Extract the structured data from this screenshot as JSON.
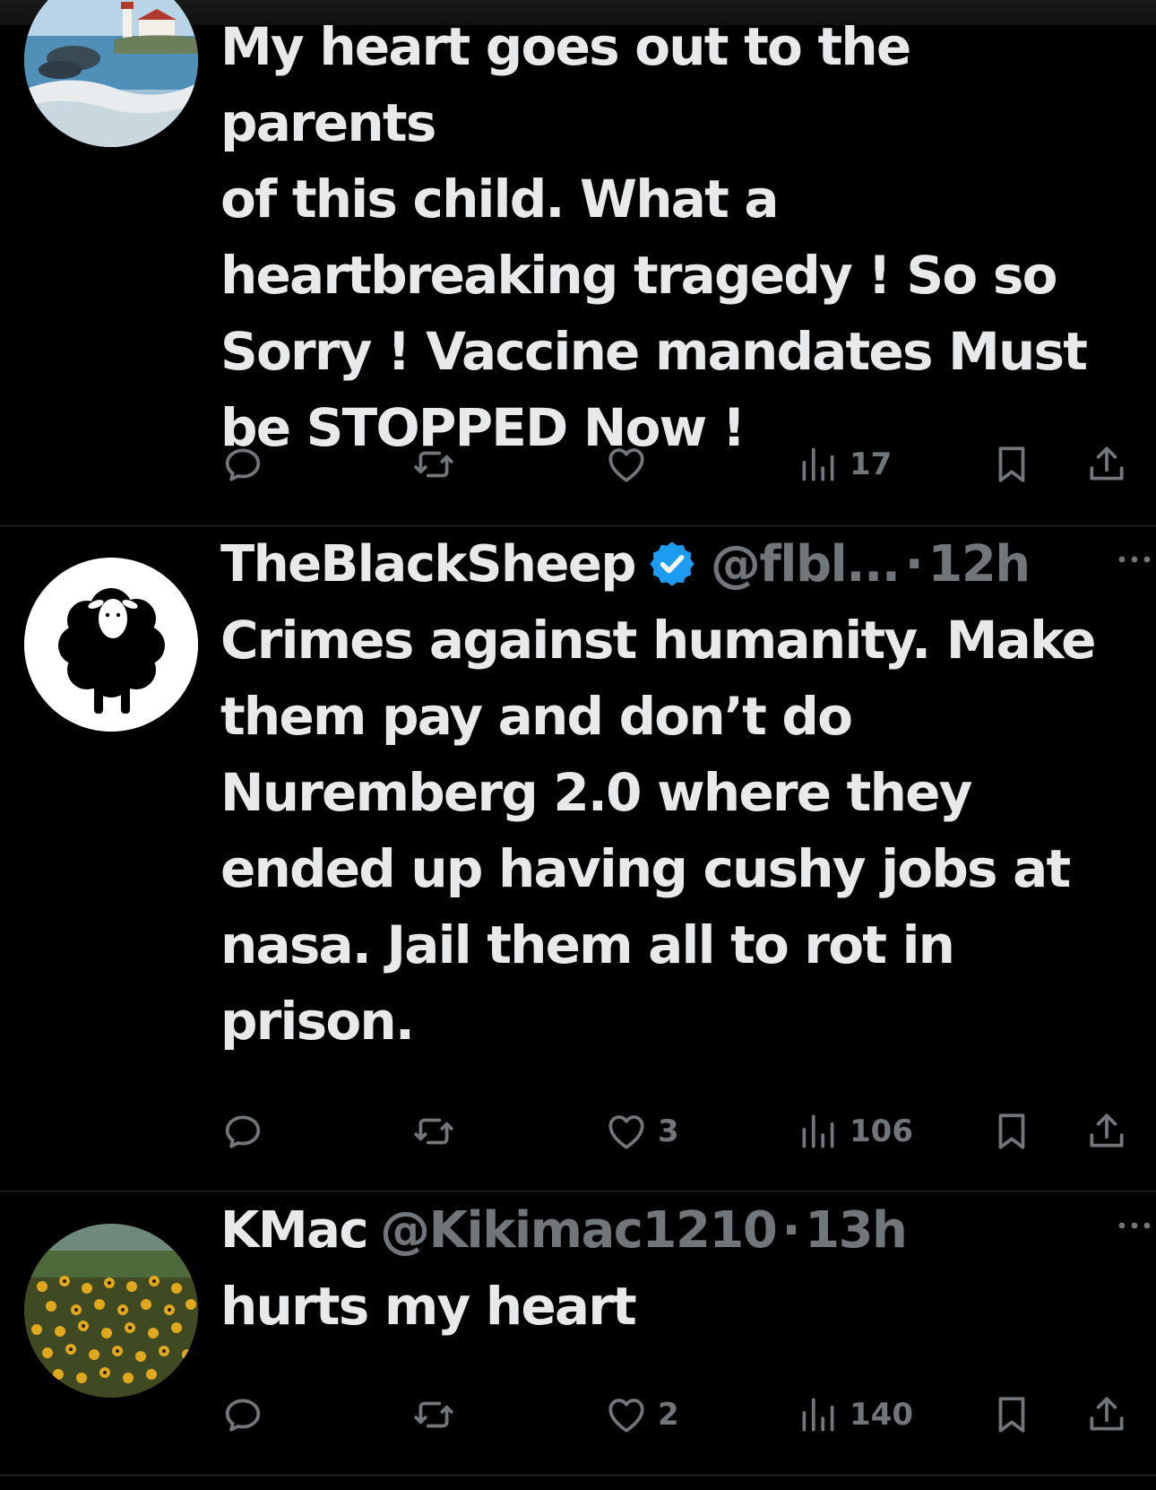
{
  "colors": {
    "background": "#000000",
    "text": "#e7e9ea",
    "muted": "#71767b",
    "divider": "#2f3336",
    "verified": "#1d9bf0"
  },
  "tweets": [
    {
      "text": "My heart goes out to the parents\nof this child. What a\nheartbreaking tragedy ! So so\nSorry ! Vaccine mandates Must\nbe STOPPED Now !",
      "avatar": "lighthouse-seascape-painting",
      "actions": {
        "reply_icon": "reply-icon",
        "retweet_icon": "retweet-icon",
        "like_icon": "heart-icon",
        "like_count": "",
        "views_icon": "views-icon",
        "views_count": "17",
        "bookmark_icon": "bookmark-icon",
        "share_icon": "share-icon"
      }
    },
    {
      "name": "TheBlackSheep",
      "verified": true,
      "handle": "@flbl...",
      "separator": "·",
      "time": "12h",
      "text": "Crimes against humanity. Make\nthem pay and don’t do\nNuremberg 2.0 where they\nended up having cushy jobs at\nnasa. Jail them all to rot in\nprison.",
      "avatar": "black-sheep-logo",
      "actions": {
        "reply_icon": "reply-icon",
        "retweet_icon": "retweet-icon",
        "like_icon": "heart-icon",
        "like_count": "3",
        "views_icon": "views-icon",
        "views_count": "106",
        "bookmark_icon": "bookmark-icon",
        "share_icon": "share-icon"
      }
    },
    {
      "name": "KMac",
      "verified": false,
      "handle": "@Kikimac1210",
      "separator": "·",
      "time": "13h",
      "text": "hurts my heart",
      "avatar": "yellow-flowers-photo",
      "actions": {
        "reply_icon": "reply-icon",
        "retweet_icon": "retweet-icon",
        "like_icon": "heart-icon",
        "like_count": "2",
        "views_icon": "views-icon",
        "views_count": "140",
        "bookmark_icon": "bookmark-icon",
        "share_icon": "share-icon"
      }
    }
  ]
}
